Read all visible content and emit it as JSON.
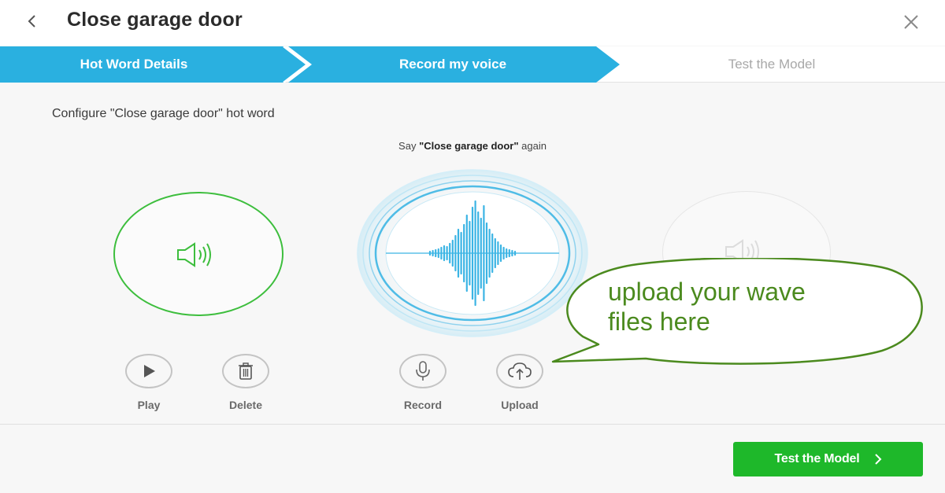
{
  "header": {
    "title": "Close garage door",
    "back_icon": "chevron-left-icon",
    "close_icon": "close-icon"
  },
  "stepper": {
    "steps": [
      {
        "label": "Hot Word Details",
        "state": "done"
      },
      {
        "label": "Record my voice",
        "state": "active"
      },
      {
        "label": "Test the Model",
        "state": "pending"
      }
    ],
    "active_color": "#2ab0e0",
    "inactive_text_color": "#a8a8a8"
  },
  "main": {
    "configure_text": "Configure \"Close garage door\" hot word",
    "say_prefix": "Say ",
    "say_phrase": "\"Close garage door\"",
    "say_suffix": " again",
    "play_circle_icon": "speaker-icon",
    "wave_icon": "sound-wave-icon",
    "accent_green": "#3dbe3d",
    "accent_blue": "#2ab0e0"
  },
  "actions": [
    {
      "label": "Play",
      "icon": "play-icon"
    },
    {
      "label": "Delete",
      "icon": "trash-icon"
    },
    {
      "label": "Record",
      "icon": "microphone-icon"
    },
    {
      "label": "Upload",
      "icon": "cloud-upload-icon"
    }
  ],
  "callout": {
    "line1": "upload your wave",
    "line2": "files here",
    "color": "#4b8a1e"
  },
  "footer": {
    "primary_label": "Test the Model",
    "primary_color": "#1eb82a"
  }
}
